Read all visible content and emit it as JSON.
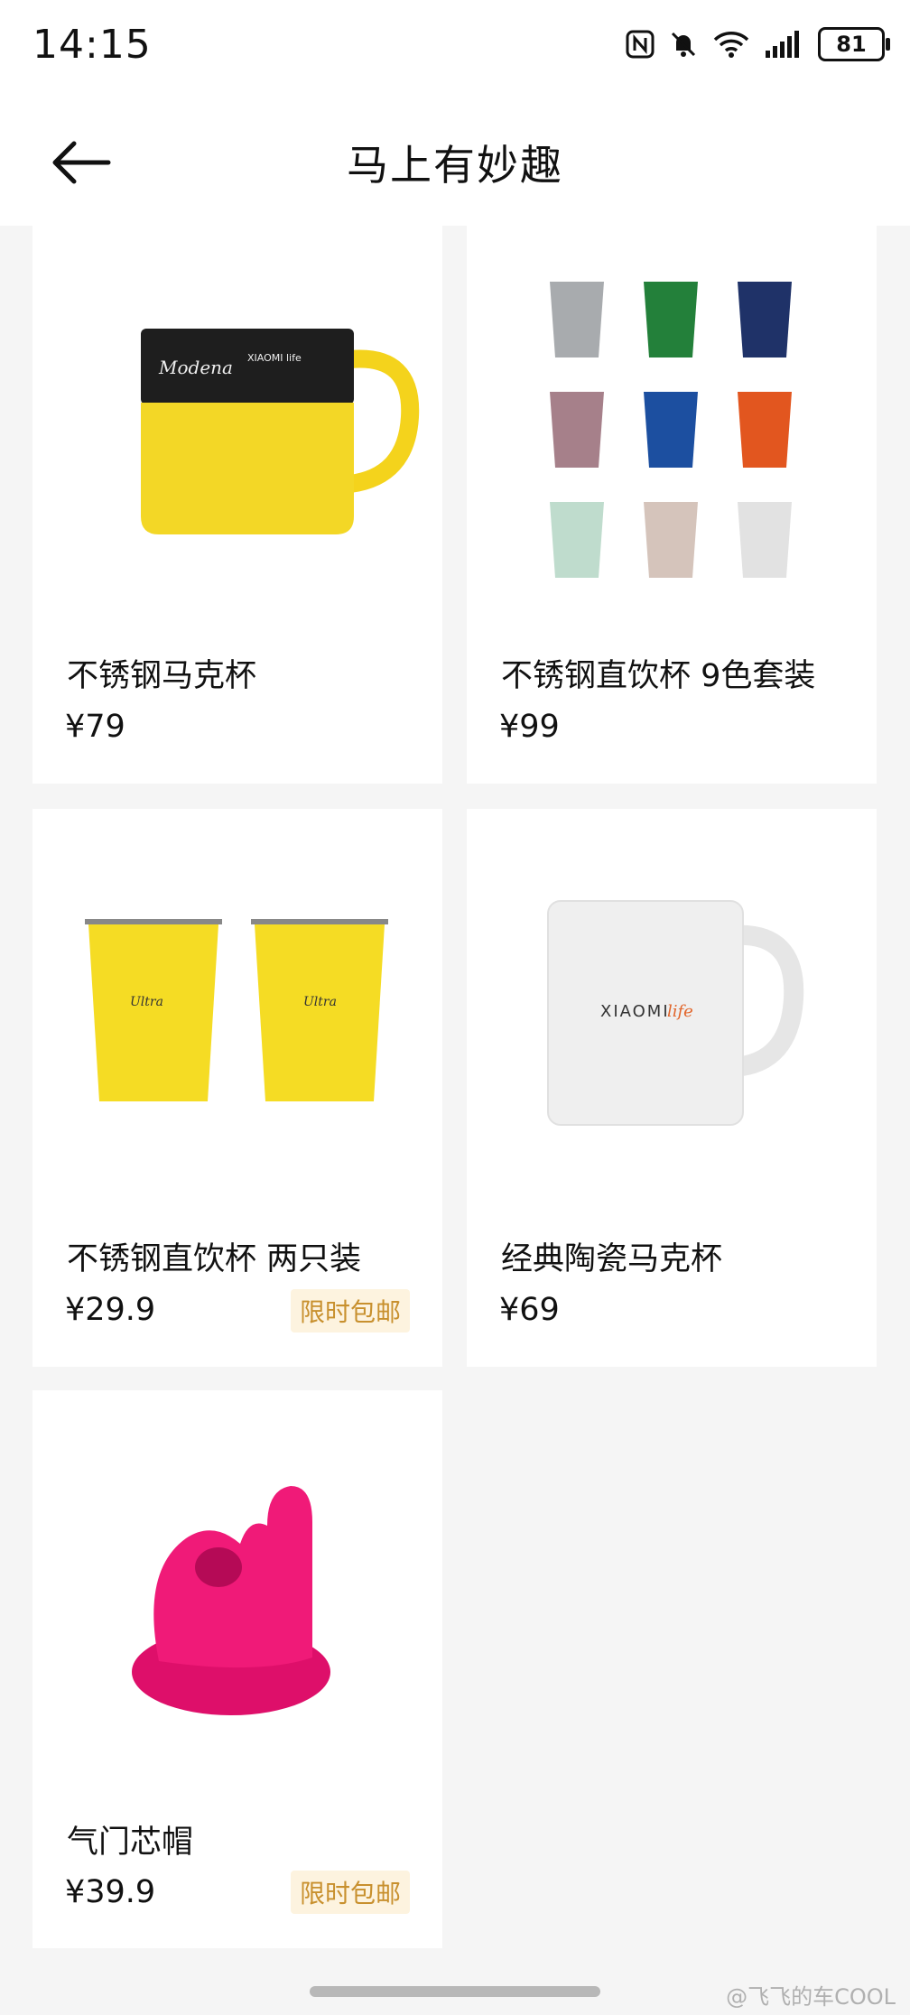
{
  "status_bar": {
    "time": "14:15",
    "battery": "81"
  },
  "header": {
    "title": "马上有妙趣"
  },
  "products": [
    {
      "name": "不锈钢马克杯",
      "price": "¥79"
    },
    {
      "name": "不锈钢直饮杯 9色套装",
      "price": "¥99"
    },
    {
      "name": "不锈钢直饮杯 两只装",
      "price": "¥29.9",
      "badge": "限时包邮"
    },
    {
      "name": "经典陶瓷马克杯",
      "price": "¥69"
    },
    {
      "name": "气门芯帽",
      "price": "¥39.9",
      "badge": "限时包邮"
    }
  ],
  "watermark": "@飞飞的车COOL",
  "colors": {
    "badge_bg": "#fdf3df",
    "badge_text": "#c8902e",
    "page_bg": "#f5f5f5"
  }
}
